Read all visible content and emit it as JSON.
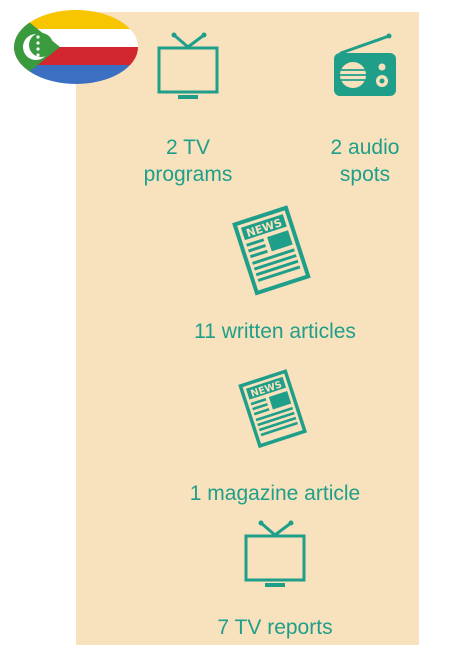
{
  "colors": {
    "panel": "#f8e1bd",
    "accent": "#1f9f8a",
    "flag_yellow": "#f7c600",
    "flag_white": "#ffffff",
    "flag_red": "#d22630",
    "flag_blue": "#3b6fc2",
    "flag_green": "#3a9a3e"
  },
  "flag": {
    "icon": "comoros-flag-icon"
  },
  "items": [
    {
      "icon": "tv-icon",
      "label_line1": "2 TV",
      "label_line2": "programs"
    },
    {
      "icon": "radio-icon",
      "label_line1": "2 audio",
      "label_line2": "spots"
    },
    {
      "icon": "newspaper-icon",
      "label": "11 written articles"
    },
    {
      "icon": "newspaper-icon",
      "label": "1 magazine article"
    },
    {
      "icon": "tv-icon",
      "label": "7 TV reports"
    }
  ]
}
